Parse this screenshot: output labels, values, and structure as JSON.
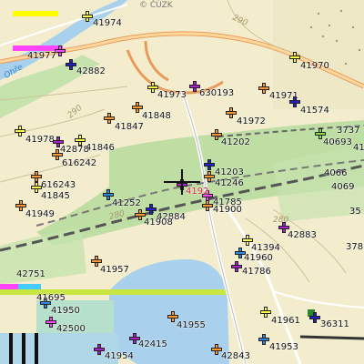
{
  "map": {
    "copyright": "© ČÚZK",
    "river_label": "Ohře",
    "elevations": [
      "290",
      "290",
      "280",
      "280"
    ],
    "points": [
      {
        "id": "41974",
        "color": "#ffff44"
      },
      {
        "id": "41977",
        "color": "#ff44ff"
      },
      {
        "id": "42882",
        "color": "#2222cc"
      },
      {
        "id": "41970",
        "color": "#ffff44"
      },
      {
        "id": "41973",
        "color": "#ffff44"
      },
      {
        "id": "630193",
        "color": "#aa22cc"
      },
      {
        "id": "41971",
        "color": "#ff9933"
      },
      {
        "id": "41848",
        "color": "#ff9933"
      },
      {
        "id": "41847",
        "color": "#ff9933"
      },
      {
        "id": "41574",
        "color": "#2222cc"
      },
      {
        "id": "41972",
        "color": "#ff9933"
      },
      {
        "id": "41978",
        "color": "#ffff44"
      },
      {
        "id": "42878",
        "color": "#aa22cc"
      },
      {
        "id": "41846",
        "color": "#ffff44"
      },
      {
        "id": "41202",
        "color": "#ff9933"
      },
      {
        "id": "40693",
        "color": "#88dd44"
      },
      {
        "id": "616242",
        "color": "#ff9933"
      },
      {
        "id": "41203",
        "color": "#2222cc"
      },
      {
        "id": "41246",
        "color": "#ff9933"
      },
      {
        "id": "616243",
        "color": "#ff9933"
      },
      {
        "id": "41845",
        "color": "#ffff44"
      },
      {
        "id": "41252",
        "color": "#3388dd"
      },
      {
        "id": "41785",
        "color": "#ff44ff"
      },
      {
        "id": "41900",
        "color": "#ff9933"
      },
      {
        "id": "41949",
        "color": "#ff9933"
      },
      {
        "id": "42884",
        "color": "#2222cc"
      },
      {
        "id": "41908",
        "color": "#ff9933"
      },
      {
        "id": "42883",
        "color": "#aa22cc"
      },
      {
        "id": "41394",
        "color": "#ffff44"
      },
      {
        "id": "41960",
        "color": "#3388dd"
      },
      {
        "id": "41957",
        "color": "#ff9933"
      },
      {
        "id": "41786",
        "color": "#aa22cc"
      },
      {
        "id": "41950",
        "color": "#3388dd"
      },
      {
        "id": "42500",
        "color": "#ff44ff"
      },
      {
        "id": "41955",
        "color": "#ff9933"
      },
      {
        "id": "41961",
        "color": "#ffff44"
      },
      {
        "id": "36311",
        "color": "#2222cc"
      },
      {
        "id": "42415",
        "color": "#aa22cc"
      },
      {
        "id": "41954",
        "color": "#aa22cc"
      },
      {
        "id": "41953",
        "color": "#3388dd"
      },
      {
        "id": "42843",
        "color": "#ff9933"
      }
    ],
    "partial_labels": [
      "41",
      "4066",
      "4069",
      "35",
      "378",
      "3737",
      "41785",
      "4192",
      "42751",
      "41695"
    ]
  }
}
